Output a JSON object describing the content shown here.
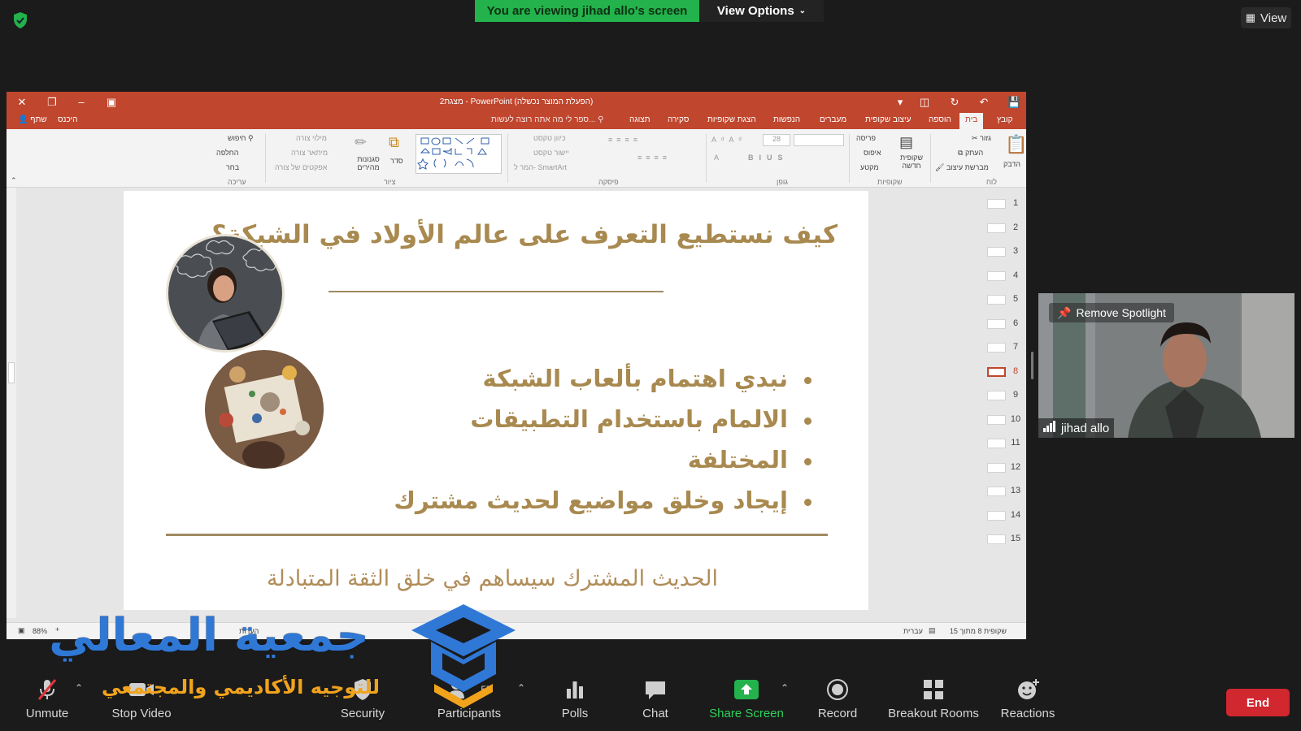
{
  "zoom": {
    "banner": "You are viewing jihad allo's screen",
    "view_options": "View Options",
    "view_label": "View",
    "remove_spotlight": "Remove Spotlight",
    "participant_name": "jihad allo",
    "participants_count": "57",
    "toolbar": {
      "unmute": "Unmute",
      "stop_video": "Stop Video",
      "security": "Security",
      "participants": "Participants",
      "polls": "Polls",
      "chat": "Chat",
      "share_screen": "Share Screen",
      "record": "Record",
      "breakout_rooms": "Breakout Rooms",
      "reactions": "Reactions",
      "end": "End"
    },
    "colors": {
      "share_green": "#23b24b",
      "end_red": "#d1272f"
    }
  },
  "ppt": {
    "window_title": "מצגת2 - PowerPoint (הפעלת המוצר נכשלה)",
    "tabs": [
      "קובץ",
      "בית",
      "הוספה",
      "עיצוב שקופית",
      "מעברים",
      "הנפשות",
      "הצגת שקופיות",
      "סקירה",
      "תצוגה"
    ],
    "tell_me": "ספר לי מה אתה רוצה לעשות...",
    "signin": "היכנס",
    "share": "שתף",
    "ribbon": {
      "groups": [
        "לוח",
        "שקופיות",
        "גופן",
        "פיסקה",
        "ציור",
        "עריכה"
      ],
      "paste": "הדבק",
      "cut": "גזור",
      "copy": "העתק",
      "format_painter": "מברשת עיצוב",
      "new_slide": "שקופית חדשה",
      "layout": "פריסה",
      "reset": "איפוס",
      "section": "מקטע",
      "font_size": "28",
      "text_direction": "כיוון טקסט",
      "align_text": "יישור טקסט",
      "convert_smartart": "המר ל- SmartArt",
      "arrange": "סדר",
      "quick_styles": "סגנונות מהירים",
      "shape_fill": "מילוי צורה",
      "shape_outline": "מיתאר צורה",
      "shape_effects": "אפקטים של צורה",
      "find": "חיפוש",
      "replace": "החלפה",
      "select": "בחר"
    },
    "status": {
      "slide_of": "שקופית 8 מתוך 15",
      "language": "עברית",
      "notes": "הערות",
      "zoom": "88%"
    },
    "thumb_numbers": [
      "1",
      "2",
      "3",
      "4",
      "5",
      "6",
      "7",
      "8",
      "9",
      "10",
      "11",
      "12",
      "13",
      "14",
      "15"
    ],
    "selected_slide": "8",
    "slide": {
      "title": "كيف نستطيع التعرف على عالم الأولاد في الشبكة؟",
      "bullets": [
        "نبدي اهتمام بألعاب الشبكة",
        "الالمام باستخدام التطبيقات",
        "المختلفة",
        "إيجاد وخلق مواضيع لحديث مشترك"
      ],
      "footer": "الحديث المشترك سيساهم في خلق الثقة المتبادلة",
      "accent_color": "#a8894f"
    }
  },
  "watermark": {
    "title": "جمعية المعالي",
    "subtitle": "للتوجيه الأكاديمي والمجتمعي"
  }
}
